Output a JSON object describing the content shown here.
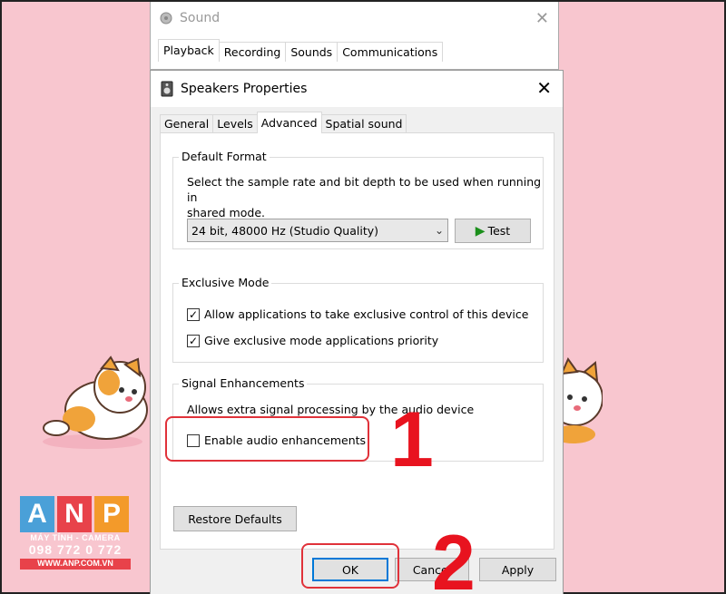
{
  "background": {
    "color": "#f8c6cf",
    "watermark": {
      "letters": [
        "A",
        "N",
        "P"
      ],
      "tagline": "MÁY TÍNH - CAMERA",
      "phone": "098 772 0 772",
      "website": "WWW.ANP.COM.VN"
    }
  },
  "sound_window": {
    "title": "Sound",
    "icon": "speaker-icon",
    "close": "✕",
    "tabs": [
      "Playback",
      "Recording",
      "Sounds",
      "Communications"
    ]
  },
  "dialog": {
    "title": "Speakers Properties",
    "icon": "speaker-device-icon",
    "close": "✕",
    "tabs": [
      "General",
      "Levels",
      "Advanced",
      "Spatial sound"
    ],
    "active_tab": "Advanced",
    "default_format": {
      "label": "Default Format",
      "description_line1": "Select the sample rate and bit depth to be used when running in",
      "description_line2": "shared mode.",
      "selected_format": "24 bit, 48000 Hz (Studio Quality)",
      "test_label": "Test"
    },
    "exclusive_mode": {
      "label": "Exclusive Mode",
      "options": [
        {
          "label": "Allow applications to take exclusive control of this device",
          "checked": true
        },
        {
          "label": "Give exclusive mode applications priority",
          "checked": true
        }
      ]
    },
    "signal_enhancements": {
      "label": "Signal Enhancements",
      "description": "Allows extra signal processing by the audio device",
      "option": {
        "label": "Enable audio enhancements",
        "checked": false
      }
    },
    "restore_defaults_label": "Restore Defaults",
    "buttons": {
      "ok": "OK",
      "cancel": "Cancel",
      "apply": "Apply"
    }
  },
  "annotations": {
    "step1": "1",
    "step2": "2",
    "color": "#e8131f"
  }
}
